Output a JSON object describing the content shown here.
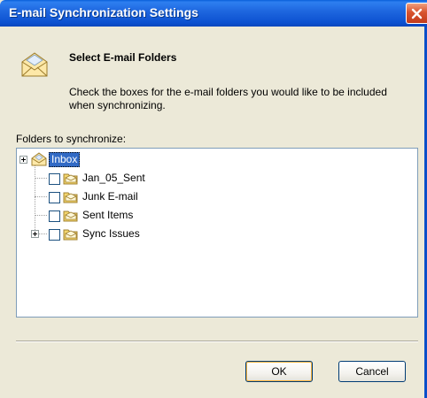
{
  "window": {
    "title": "E-mail Synchronization Settings"
  },
  "header": {
    "title": "Select E-mail Folders",
    "description": "Check the boxes for the e-mail folders you would like to be included when synchronizing.",
    "icon": "envelope-icon"
  },
  "folders": {
    "label": "Folders to synchronize:",
    "items": [
      {
        "label": "Inbox",
        "checked": false,
        "expandable": true,
        "selected": true,
        "icon": "inbox-icon"
      },
      {
        "label": "Jan_05_Sent",
        "checked": false,
        "expandable": false,
        "selected": false,
        "icon": "folder-icon"
      },
      {
        "label": "Junk E-mail",
        "checked": false,
        "expandable": false,
        "selected": false,
        "icon": "folder-icon"
      },
      {
        "label": "Sent Items",
        "checked": false,
        "expandable": false,
        "selected": false,
        "icon": "folder-icon"
      },
      {
        "label": "Sync Issues",
        "checked": false,
        "expandable": true,
        "selected": false,
        "icon": "folder-icon"
      }
    ]
  },
  "buttons": {
    "ok": "OK",
    "cancel": "Cancel"
  },
  "colors": {
    "titlebar": "#0a5fd9",
    "selection": "#316ac5",
    "dialog_bg": "#ece9d8"
  }
}
